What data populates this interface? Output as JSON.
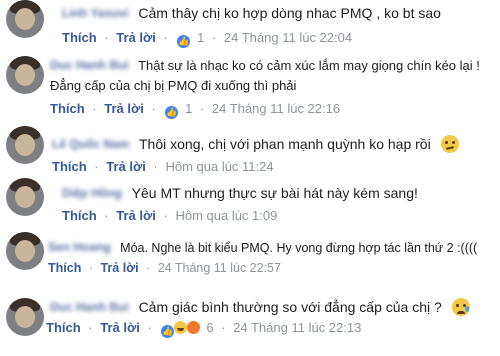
{
  "comments": [
    {
      "author": "Linh Yasuvi",
      "text": "Cảm thây chị ko hợp dòng nhac PMQ , ko bt sao",
      "actions": {
        "like": "Thích",
        "reply": "Trả lời",
        "reaction_count": "1",
        "time": "24 Tháng 11 lúc 22:04"
      }
    },
    {
      "author": "Duc Hanh Bui",
      "text_lines": [
        "Thật sự là nhạc ko có cảm xúc lắm may giọng chín kéo lại !",
        "Đẳng cấp của chị bị PMQ đi xuống thì phải"
      ],
      "actions": {
        "like": "Thích",
        "reply": "Trả lời",
        "reaction_count": "1",
        "time": "24 Tháng 11 lúc 22:16"
      }
    },
    {
      "author": "Lê Quốc Nam",
      "text": "Thôi xong, chị với phan mạnh quỳnh ko hạp rồi",
      "actions": {
        "like": "Thích",
        "reply": "Trả lời",
        "time": "Hôm qua lúc 11:24"
      }
    },
    {
      "author": "Diệp Hồng",
      "text": "Yêu MT nhưng thực sự bài hát này kém sang!",
      "actions": {
        "like": "Thích",
        "reply": "Trả lời",
        "time": "Hôm qua lúc 1:09"
      }
    },
    {
      "author": "Sen Hoang",
      "text": "Móa. Nghe là bit kiểu PMQ. Hy vong đừng hợp tác lần thứ 2 :((((",
      "actions": {
        "like": "Thích",
        "reply": "Trả lời",
        "time": "24 Tháng 11 lúc 22:57"
      }
    },
    {
      "author": "Duc Hanh Bui",
      "text": "Cảm giác bình thường so với đẳng cấp của chị ?",
      "actions": {
        "like": "Thích",
        "reply": "Trả lời",
        "reaction_count": "6",
        "time": "24 Tháng 11 lúc 22:13"
      }
    }
  ],
  "separator": "·",
  "icons": {
    "like": "like-reaction-icon",
    "haha": "haha-reaction-icon",
    "angry": "angry-reaction-icon",
    "emoji_confused": "confused-emoji-icon",
    "emoji_cry": "crying-emoji-icon"
  },
  "colors": {
    "action": "#385898",
    "meta": "#8d949e",
    "text": "#1c1e21",
    "like": "#3b82f6"
  }
}
